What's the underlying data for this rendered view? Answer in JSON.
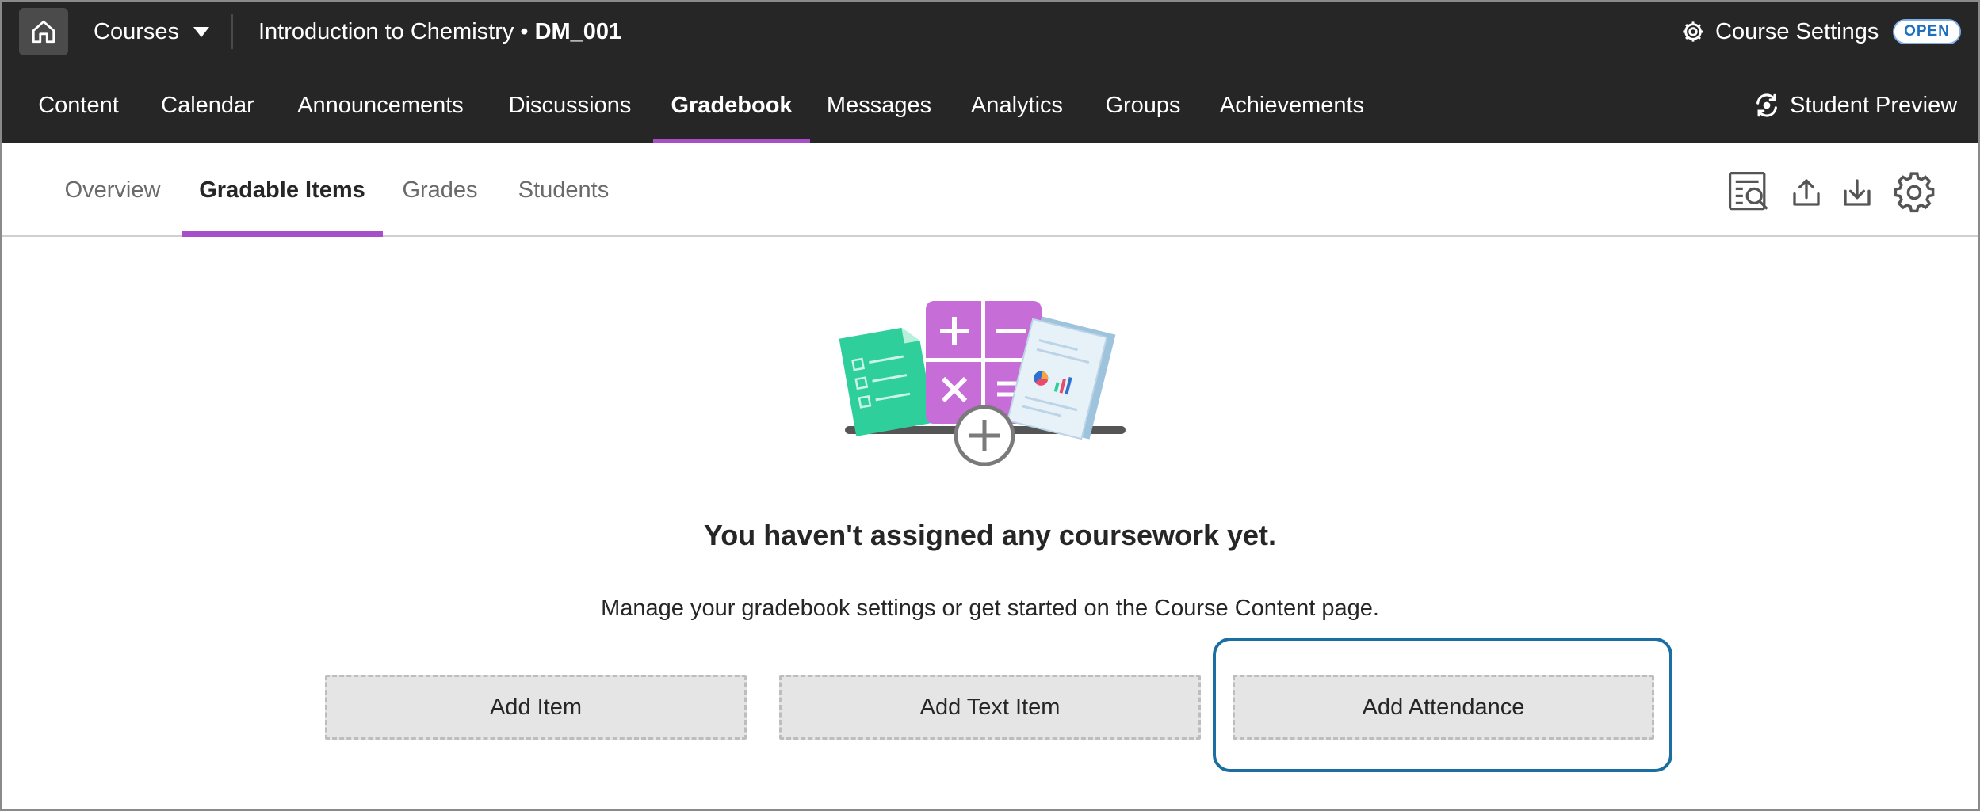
{
  "topbar": {
    "courses_label": "Courses",
    "course_name": "Introduction to Chemistry •",
    "course_code": "DM_001",
    "settings_label": "Course Settings",
    "status_badge": "OPEN"
  },
  "mainnav": {
    "items": [
      {
        "label": "Content"
      },
      {
        "label": "Calendar"
      },
      {
        "label": "Announcements"
      },
      {
        "label": "Discussions"
      },
      {
        "label": "Gradebook",
        "active": true
      },
      {
        "label": "Messages"
      },
      {
        "label": "Analytics"
      },
      {
        "label": "Groups"
      },
      {
        "label": "Achievements"
      }
    ],
    "student_preview_label": "Student Preview"
  },
  "subnav": {
    "tabs": [
      {
        "label": "Overview"
      },
      {
        "label": "Gradable Items",
        "active": true
      },
      {
        "label": "Grades"
      },
      {
        "label": "Students"
      }
    ],
    "tools": [
      "search-report-icon",
      "upload-icon",
      "download-icon",
      "gear-icon"
    ]
  },
  "empty_state": {
    "illustration": "gradebook-calculator-illustration",
    "title": "You haven't assigned any coursework yet.",
    "description": "Manage your gradebook settings or get started on the Course Content page."
  },
  "actions": {
    "add_item": "Add Item",
    "add_text_item": "Add Text Item",
    "add_attendance": "Add Attendance"
  },
  "colors": {
    "header_bg": "#262626",
    "accent_purple": "#a64fc9",
    "badge_blue": "#1f6fc1",
    "focus_ring": "#1a6fa0",
    "button_bg": "#e5e5e5"
  }
}
